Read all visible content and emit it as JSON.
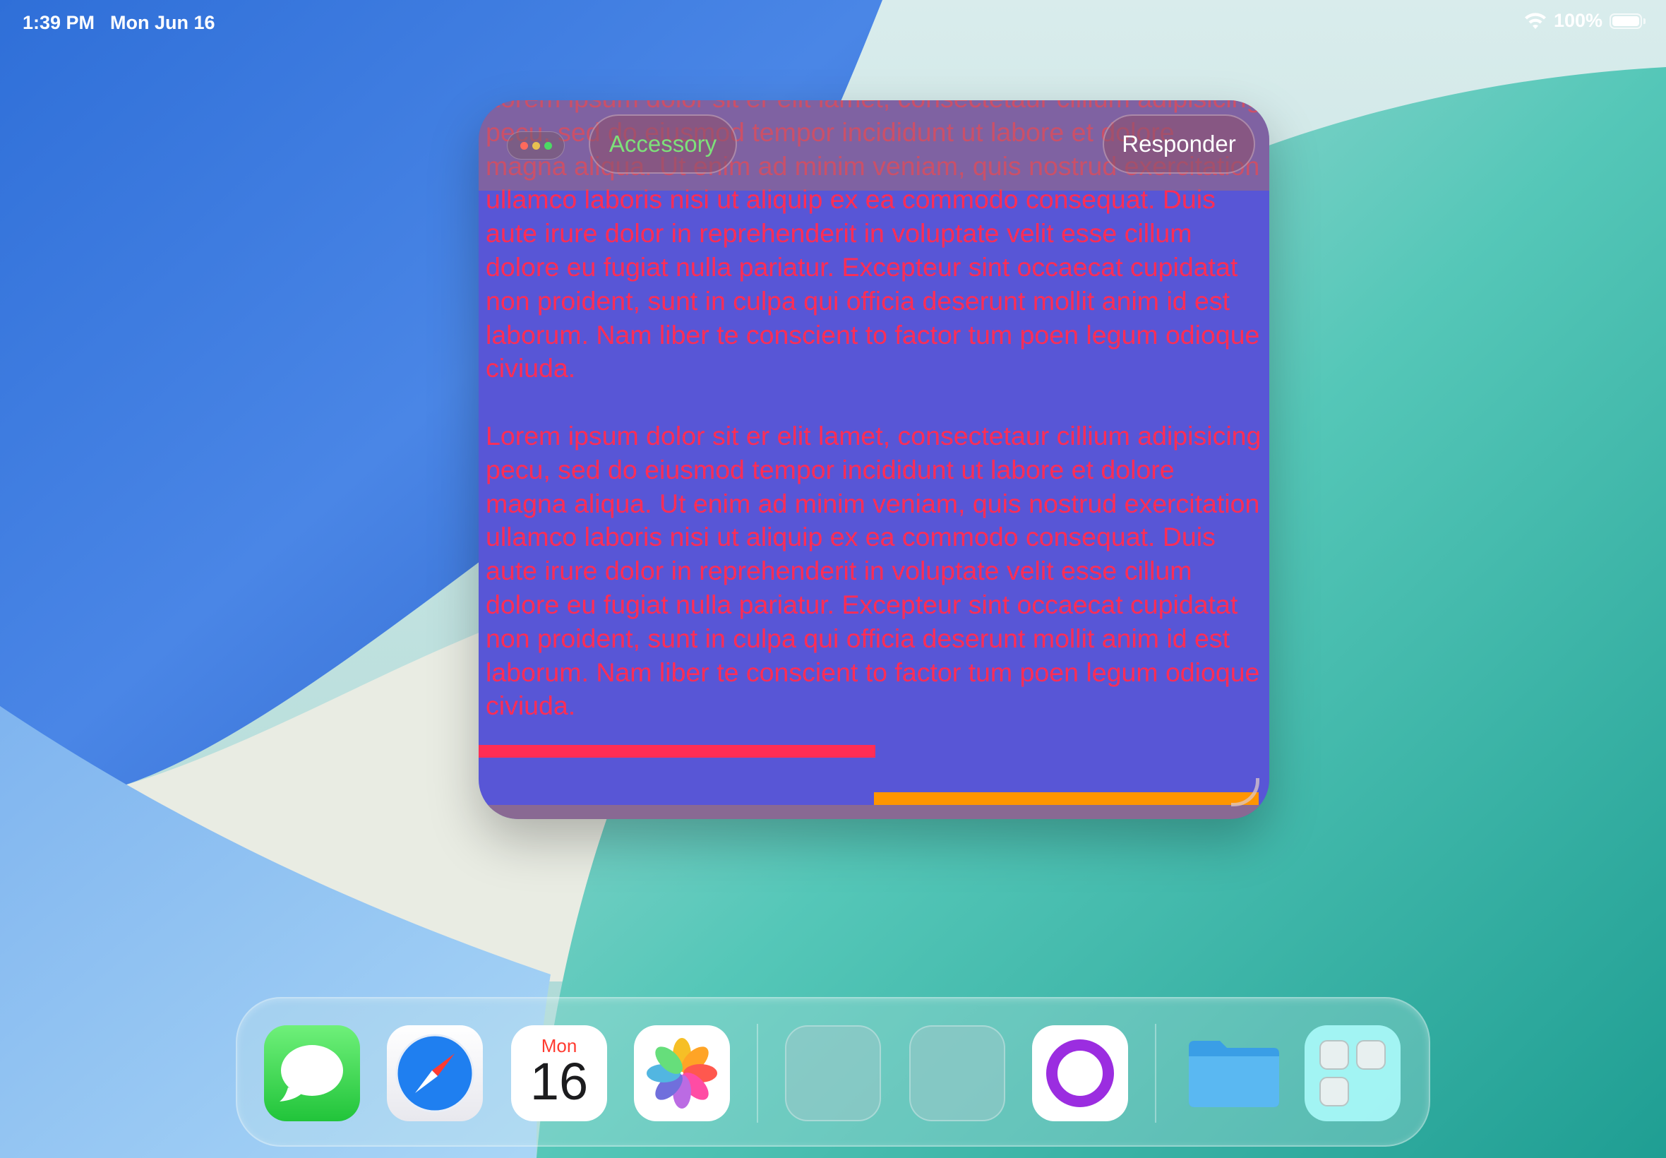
{
  "status_bar": {
    "time": "1:39 PM",
    "date": "Mon Jun 16",
    "battery": "100%",
    "icons": [
      "wifi-icon",
      "battery-icon"
    ]
  },
  "window": {
    "background_color": "#5856d6",
    "text_color": "#ff2d55",
    "controls": [
      "red",
      "yellow",
      "green"
    ],
    "accessory_label": "Accessory",
    "responder_label": "Responder",
    "paragraphs": [
      "Lorem ipsum dolor sit er elit lamet, consectetaur cillium adipisicing pecu, sed do eiusmod tempor incididunt ut labore et dolore magna aliqua. Ut enim ad minim veniam, quis nostrud exercitation ullamco laboris nisi ut aliquip ex ea commodo consequat. Duis aute irure dolor in reprehenderit in voluptate velit esse cillum dolore eu fugiat nulla pariatur. Excepteur sint occaecat cupidatat non proident, sunt in culpa qui officia deserunt mollit anim id est laborum. Nam liber te conscient to factor tum poen legum odioque civiuda.",
      "Lorem ipsum dolor sit er elit lamet, consectetaur cillium adipisicing pecu, sed do eiusmod tempor incididunt ut labore et dolore magna aliqua. Ut enim ad minim veniam, quis nostrud exercitation ullamco laboris nisi ut aliquip ex ea commodo consequat. Duis aute irure dolor in reprehenderit in voluptate velit esse cillum dolore eu fugiat nulla pariatur. Excepteur sint occaecat cupidatat non proident, sunt in culpa qui officia deserunt mollit anim id est laborum. Nam liber te conscient to factor tum poen legum odioque civiuda."
    ],
    "bar_colors": {
      "red": "#ff2d55",
      "orange": "#ff9500"
    }
  },
  "dock": {
    "apps": [
      {
        "name": "Messages",
        "icon": "messages-icon"
      },
      {
        "name": "Safari",
        "icon": "safari-icon"
      },
      {
        "name": "Calendar",
        "icon": "calendar-icon"
      },
      {
        "name": "Photos",
        "icon": "photos-icon"
      },
      {
        "name": "",
        "icon": "placeholder-app-icon"
      },
      {
        "name": "",
        "icon": "placeholder-app-icon"
      },
      {
        "name": "",
        "icon": "circle-app-icon"
      },
      {
        "name": "Files",
        "icon": "folder-icon"
      },
      {
        "name": "App Library",
        "icon": "app-library-icon"
      }
    ],
    "calendar": {
      "day": "Mon",
      "date": "16"
    }
  }
}
